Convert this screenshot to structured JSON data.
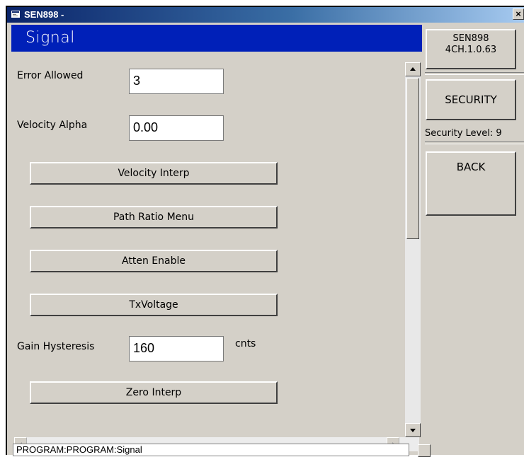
{
  "window": {
    "title": "SEN898 -",
    "close_label": "×"
  },
  "panel": {
    "title": "Signal",
    "error_allowed": {
      "label": "Error Allowed",
      "value": "3"
    },
    "velocity_alpha": {
      "label": "Velocity Alpha",
      "value": "0.00"
    },
    "buttons": [
      "Velocity Interp",
      "Path Ratio Menu",
      "Atten Enable",
      "TxVoltage"
    ],
    "gain_hysteresis": {
      "label": "Gain Hysteresis",
      "value": "160",
      "unit": "cnts"
    },
    "zero_interp": "Zero Interp"
  },
  "sidebar": {
    "version_line1": "SEN898",
    "version_line2": "4CH.1.0.63",
    "security_button": "SECURITY",
    "security_level": "Security Level: 9",
    "back_button": "BACK"
  },
  "status": {
    "text": "PROGRAM:PROGRAM:Signal"
  },
  "colors": {
    "panel_header": "#0020b8",
    "titlebar_start": "#0a246a",
    "face": "#d4d0c8"
  },
  "icons": {
    "window_icon": "app-window-icon"
  }
}
